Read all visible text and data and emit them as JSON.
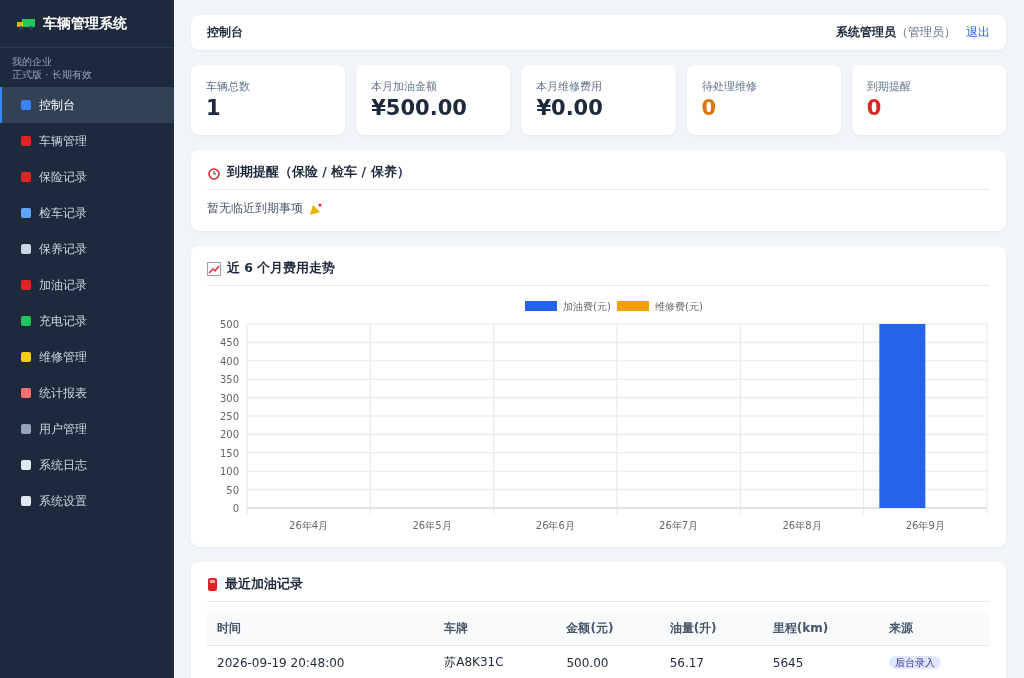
{
  "sidebar": {
    "brand": "车辆管理系统",
    "company": "我的企业",
    "license": "正式版 · 长期有效",
    "items": [
      {
        "label": "控制台",
        "selected": true
      },
      {
        "label": "车辆管理",
        "selected": false
      },
      {
        "label": "保险记录",
        "selected": false
      },
      {
        "label": "检车记录",
        "selected": false
      },
      {
        "label": "保养记录",
        "selected": false
      },
      {
        "label": "加油记录",
        "selected": false
      },
      {
        "label": "充电记录",
        "selected": false
      },
      {
        "label": "维修管理",
        "selected": false
      },
      {
        "label": "统计报表",
        "selected": false
      },
      {
        "label": "用户管理",
        "selected": false
      },
      {
        "label": "系统日志",
        "selected": false
      },
      {
        "label": "系统设置",
        "selected": false
      }
    ]
  },
  "header": {
    "title": "控制台",
    "user": "系统管理员",
    "role": "（管理员）",
    "logout": "退出"
  },
  "stats": [
    {
      "label": "车辆总数",
      "value": "1",
      "color": "#1e293b"
    },
    {
      "label": "本月加油金额",
      "value": "¥500.00",
      "color": "#1e293b"
    },
    {
      "label": "本月维修费用",
      "value": "¥0.00",
      "color": "#1e293b"
    },
    {
      "label": "待处理维修",
      "value": "0",
      "color": "#d97706"
    },
    {
      "label": "到期提醒",
      "value": "0",
      "color": "#dc2626"
    }
  ],
  "reminders": {
    "title": "到期提醒（保险 / 检车 / 保养）",
    "empty": "暂无临近到期事项"
  },
  "trend": {
    "title": "近 6 个月费用走势",
    "chart_data": {
      "type": "bar",
      "categories": [
        "26年4月",
        "26年5月",
        "26年6月",
        "26年7月",
        "26年8月",
        "26年9月"
      ],
      "series": [
        {
          "name": "加油费(元)",
          "color": "#2563eb",
          "values": [
            0,
            0,
            0,
            0,
            0,
            500
          ]
        },
        {
          "name": "维修费(元)",
          "color": "#f59e0b",
          "values": [
            0,
            0,
            0,
            0,
            0,
            0
          ]
        }
      ],
      "ylim": [
        0,
        500
      ],
      "grid": true,
      "yticks": [
        0,
        50,
        100,
        150,
        200,
        250,
        300,
        350,
        400,
        450,
        500
      ]
    }
  },
  "fuel": {
    "title": "最近加油记录",
    "columns": [
      "时间",
      "车牌",
      "金额(元)",
      "油量(升)",
      "里程(km)",
      "来源"
    ],
    "rows": [
      {
        "cells": [
          "2026-09-19 20:48:00",
          "苏A8K31C",
          "500.00",
          "56.17",
          "5645"
        ],
        "source": "后台录入"
      }
    ]
  }
}
